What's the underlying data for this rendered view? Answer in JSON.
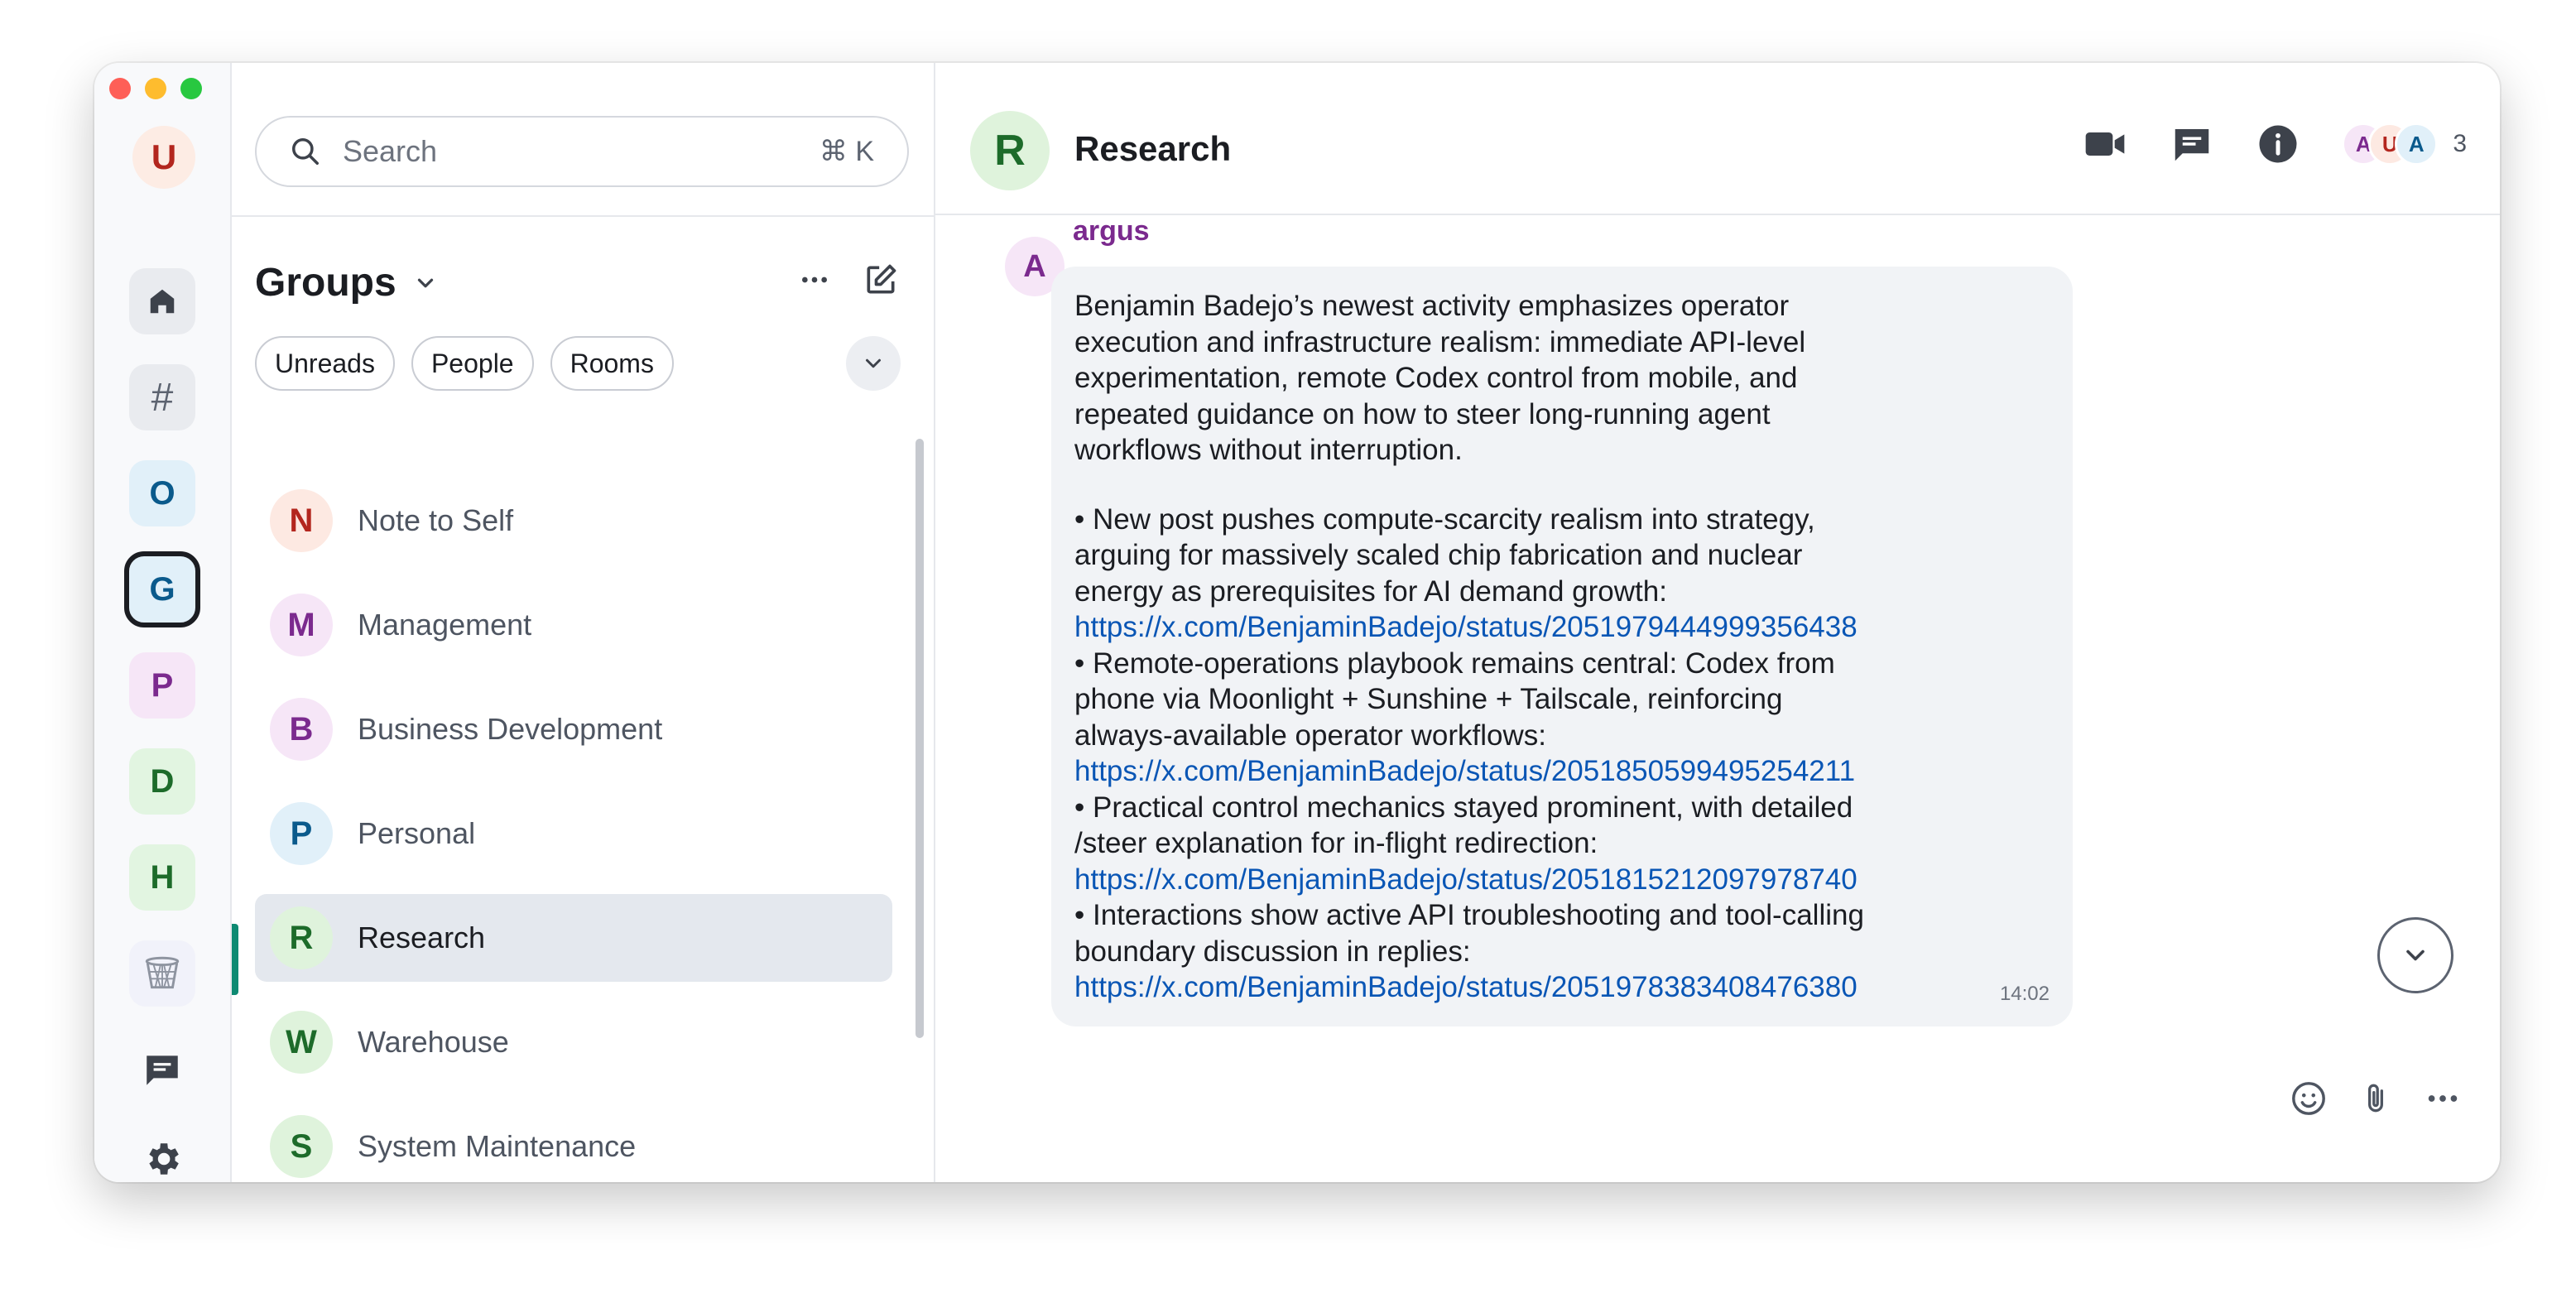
{
  "rail": {
    "user_initial": "U",
    "spaces": [
      {
        "initial": "#"
      },
      {
        "initial": "O"
      },
      {
        "initial": "G"
      },
      {
        "initial": "P"
      },
      {
        "initial": "D"
      },
      {
        "initial": "H"
      }
    ]
  },
  "search": {
    "placeholder": "Search",
    "shortcut": "⌘ K"
  },
  "sidebar": {
    "title": "Groups",
    "filters": [
      "Unreads",
      "People",
      "Rooms"
    ],
    "rooms": [
      {
        "initial": "N",
        "name": "Note to Self",
        "bg": "#fde9e2",
        "fg": "#b3261e"
      },
      {
        "initial": "M",
        "name": "Management",
        "bg": "#f6e6f7",
        "fg": "#7b2a8e"
      },
      {
        "initial": "B",
        "name": "Business Development",
        "bg": "#f6e6f7",
        "fg": "#7b2a8e"
      },
      {
        "initial": "P",
        "name": "Personal",
        "bg": "#e1f0f9",
        "fg": "#0a5a8c"
      },
      {
        "initial": "R",
        "name": "Research",
        "bg": "#dff3dc",
        "fg": "#1d6b2a",
        "selected": true
      },
      {
        "initial": "W",
        "name": "Warehouse",
        "bg": "#dff3dc",
        "fg": "#1d6b2a"
      },
      {
        "initial": "S",
        "name": "System Maintenance",
        "bg": "#dff3dc",
        "fg": "#1d6b2a"
      }
    ]
  },
  "room": {
    "initial": "R",
    "title": "Research",
    "members": [
      {
        "initial": "A",
        "bg": "#f6e6f7",
        "fg": "#7b2a8e"
      },
      {
        "initial": "U",
        "bg": "#fde9e2",
        "fg": "#b3261e"
      },
      {
        "initial": "A",
        "bg": "#e1f0f9",
        "fg": "#0a5a8c"
      }
    ],
    "member_count": "3"
  },
  "message": {
    "sender": "argus",
    "sender_initial": "A",
    "intro_lines": [
      "Benjamin Badejo’s newest activity emphasizes operator",
      "execution and infrastructure realism: immediate API-level",
      "experimentation, remote Codex control from mobile, and",
      "repeated guidance on how to steer long-running agent",
      "workflows without interruption."
    ],
    "bullets": [
      {
        "lines": [
          "• New post pushes compute-scarcity realism into strategy,",
          "arguing for massively scaled chip fabrication and nuclear",
          "energy as prerequisites for AI demand growth:"
        ],
        "link": "https://x.com/BenjaminBadejo/status/2051979444999356438"
      },
      {
        "lines": [
          "• Remote-operations playbook remains central: Codex from",
          "phone via Moonlight + Sunshine + Tailscale, reinforcing",
          "always-available operator workflows:"
        ],
        "link": "https://x.com/BenjaminBadejo/status/2051850599495254211"
      },
      {
        "lines": [
          "• Practical control mechanics stayed prominent, with detailed",
          "/steer explanation for in-flight redirection:"
        ],
        "link": "https://x.com/BenjaminBadejo/status/2051815212097978740"
      },
      {
        "lines": [
          "• Interactions show active API troubleshooting and tool-calling",
          "boundary discussion in replies:"
        ],
        "link": "https://x.com/BenjaminBadejo/status/2051978383408476380"
      }
    ],
    "time": "14:02"
  },
  "colors": {
    "accent": "#0e8a72",
    "link": "#0a56b5",
    "sender": "#7b2a8e"
  }
}
